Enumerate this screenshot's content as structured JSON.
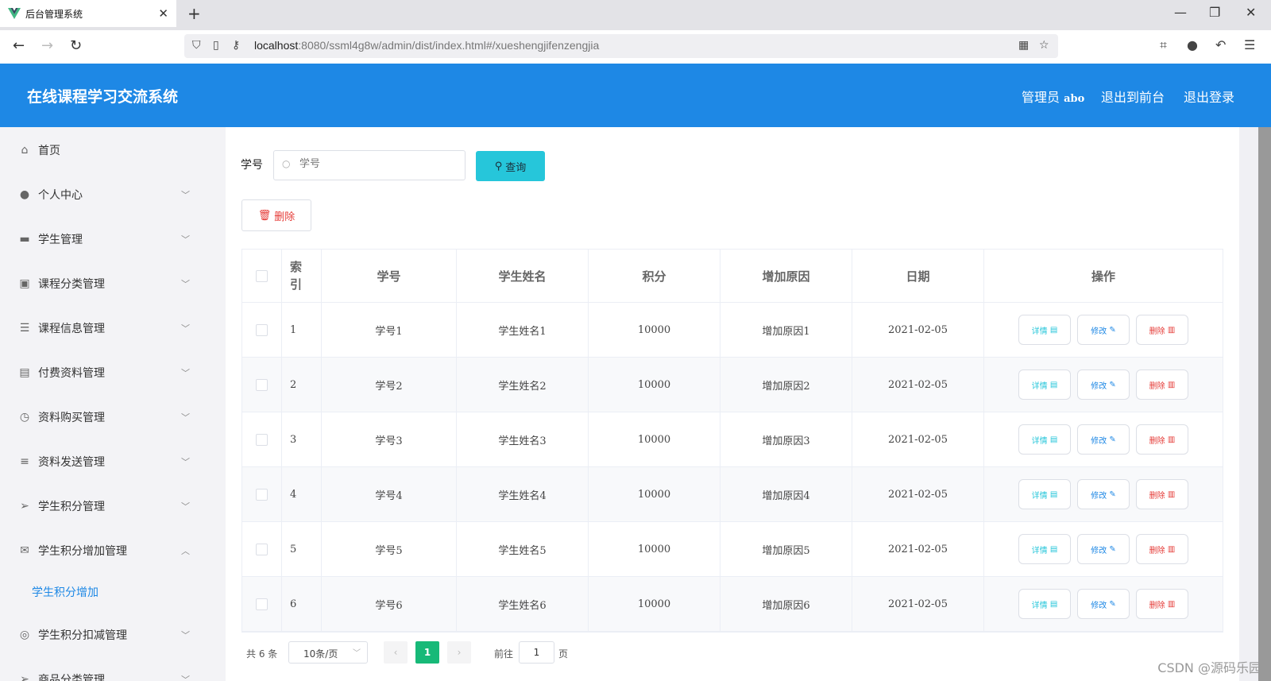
{
  "browser": {
    "tab_title": "后台管理系统",
    "url_host": "localhost",
    "url_rest": ":8080/ssml4g8w/admin/dist/index.html#/xueshengjifenzengjia"
  },
  "header": {
    "title": "在线课程学习交流系统",
    "admin_label": "管理员",
    "admin_name": "abo",
    "to_front": "退出到前台",
    "logout": "退出登录"
  },
  "sidebar": {
    "items": [
      {
        "label": "首页",
        "icon": "home-icon"
      },
      {
        "label": "个人中心",
        "icon": "user-icon"
      },
      {
        "label": "学生管理",
        "icon": "monitor-icon"
      },
      {
        "label": "课程分类管理",
        "icon": "briefcase-icon"
      },
      {
        "label": "课程信息管理",
        "icon": "sliders-icon"
      },
      {
        "label": "付费资料管理",
        "icon": "clipboard-check-icon"
      },
      {
        "label": "资料购买管理",
        "icon": "clock-icon"
      },
      {
        "label": "资料发送管理",
        "icon": "list-icon"
      },
      {
        "label": "学生积分管理",
        "icon": "send-icon"
      },
      {
        "label": "学生积分增加管理",
        "icon": "mail-icon"
      },
      {
        "label": "学生积分扣减管理",
        "icon": "target-icon"
      },
      {
        "label": "商品分类管理",
        "icon": "send-icon"
      }
    ],
    "sub_item": "学生积分增加"
  },
  "search": {
    "label": "学号",
    "placeholder": "学号",
    "button": "查询"
  },
  "actions": {
    "delete": "删除"
  },
  "table": {
    "headers": [
      "索引",
      "学号",
      "学生姓名",
      "积分",
      "增加原因",
      "日期",
      "操作"
    ],
    "rows": [
      {
        "index": "1",
        "student_no": "学号1",
        "name": "学生姓名1",
        "points": "10000",
        "reason": "增加原因1",
        "date": "2021-02-05"
      },
      {
        "index": "2",
        "student_no": "学号2",
        "name": "学生姓名2",
        "points": "10000",
        "reason": "增加原因2",
        "date": "2021-02-05"
      },
      {
        "index": "3",
        "student_no": "学号3",
        "name": "学生姓名3",
        "points": "10000",
        "reason": "增加原因3",
        "date": "2021-02-05"
      },
      {
        "index": "4",
        "student_no": "学号4",
        "name": "学生姓名4",
        "points": "10000",
        "reason": "增加原因4",
        "date": "2021-02-05"
      },
      {
        "index": "5",
        "student_no": "学号5",
        "name": "学生姓名5",
        "points": "10000",
        "reason": "增加原因5",
        "date": "2021-02-05"
      },
      {
        "index": "6",
        "student_no": "学号6",
        "name": "学生姓名6",
        "points": "10000",
        "reason": "增加原因6",
        "date": "2021-02-05"
      }
    ],
    "op_detail": "详情",
    "op_edit": "修改",
    "op_delete": "删除"
  },
  "pagination": {
    "total": "共 6 条",
    "page_size": "10条/页",
    "current_page": "1",
    "goto_prefix": "前往",
    "goto_value": "1",
    "goto_suffix": "页"
  },
  "watermark": "CSDN @源码乐园",
  "colors": {
    "header_bg": "#1e88e5",
    "search_btn": "#26c6da",
    "active_page": "#17b978",
    "danger": "#e53935"
  }
}
